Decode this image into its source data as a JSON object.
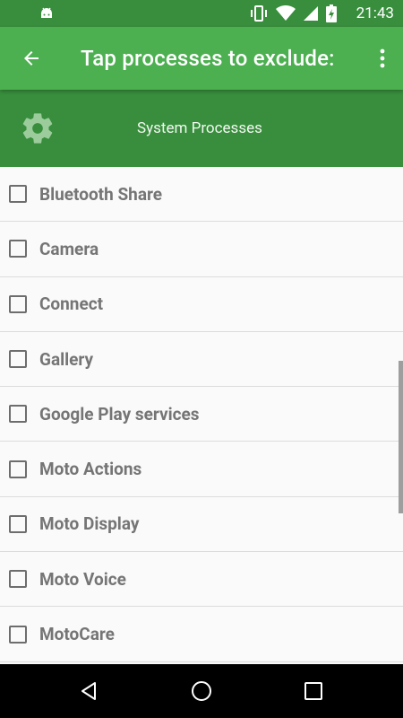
{
  "status_bar": {
    "time": "21:43",
    "icons": [
      "android-icon",
      "vibrate-icon",
      "wifi-icon",
      "signal-icon",
      "battery-icon"
    ]
  },
  "app_bar": {
    "title": "Tap processes to exclude:",
    "back_icon": "arrow-back-icon",
    "menu_icon": "more-vert-icon"
  },
  "section": {
    "title": "System Processes",
    "icon": "gear-icon"
  },
  "processes": [
    {
      "label": "Bluetooth Share",
      "checked": false
    },
    {
      "label": "Camera",
      "checked": false
    },
    {
      "label": "Connect",
      "checked": false
    },
    {
      "label": "Gallery",
      "checked": false
    },
    {
      "label": "Google Play services",
      "checked": false
    },
    {
      "label": "Moto Actions",
      "checked": false
    },
    {
      "label": "Moto Display",
      "checked": false
    },
    {
      "label": "Moto Voice",
      "checked": false
    },
    {
      "label": "MotoCare",
      "checked": false
    }
  ],
  "nav_bar": {
    "back_icon": "nav-back-icon",
    "home_icon": "nav-home-icon",
    "recents_icon": "nav-recents-icon"
  },
  "colors": {
    "primary": "#4caf50",
    "primary_dark": "#388e3c",
    "list_background": "#fafafa",
    "item_text": "#757575"
  }
}
